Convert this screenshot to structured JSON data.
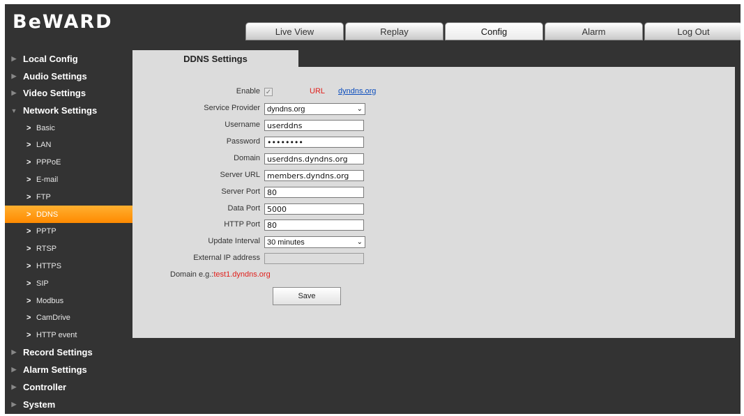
{
  "logo": "BeWARD",
  "tabs": [
    "Live View",
    "Replay",
    "Config",
    "Alarm",
    "Log Out"
  ],
  "sidebar": {
    "local_config": "Local Config",
    "audio_settings": "Audio Settings",
    "video_settings": "Video Settings",
    "network_settings": "Network Settings",
    "network_items": [
      "Basic",
      "LAN",
      "PPPoE",
      "E-mail",
      "FTP",
      "DDNS",
      "PPTP",
      "RTSP",
      "HTTPS",
      "SIP",
      "Modbus",
      "CamDrive",
      "HTTP event"
    ],
    "record_settings": "Record Settings",
    "alarm_settings": "Alarm Settings",
    "controller": "Controller",
    "system": "System"
  },
  "content": {
    "tab_title": "DDNS Settings",
    "enable_label": "Enable",
    "enable_checked": true,
    "url_label": "URL",
    "url_link": "dyndns.org",
    "service_provider_label": "Service Provider",
    "service_provider_value": "dyndns.org",
    "username_label": "Username",
    "username_value": "userddns",
    "password_label": "Password",
    "password_value": "••••••••",
    "domain_label": "Domain",
    "domain_value": "userddns.dyndns.org",
    "server_url_label": "Server URL",
    "server_url_value": "members.dyndns.org",
    "server_port_label": "Server Port",
    "server_port_value": "80",
    "data_port_label": "Data Port",
    "data_port_value": "5000",
    "http_port_label": "HTTP Port",
    "http_port_value": "80",
    "update_interval_label": "Update Interval",
    "update_interval_value": "30 minutes",
    "external_ip_label": "External IP address",
    "external_ip_value": "",
    "example_prefix": "Domain e.g.:",
    "example_value": "test1.dyndns.org",
    "save_label": "Save"
  },
  "colors": {
    "background": "#333333",
    "panel": "#dcdcdc",
    "active_item": "#ff9a10",
    "accent_red": "#e0201c",
    "link_blue": "#0b4dbd"
  }
}
